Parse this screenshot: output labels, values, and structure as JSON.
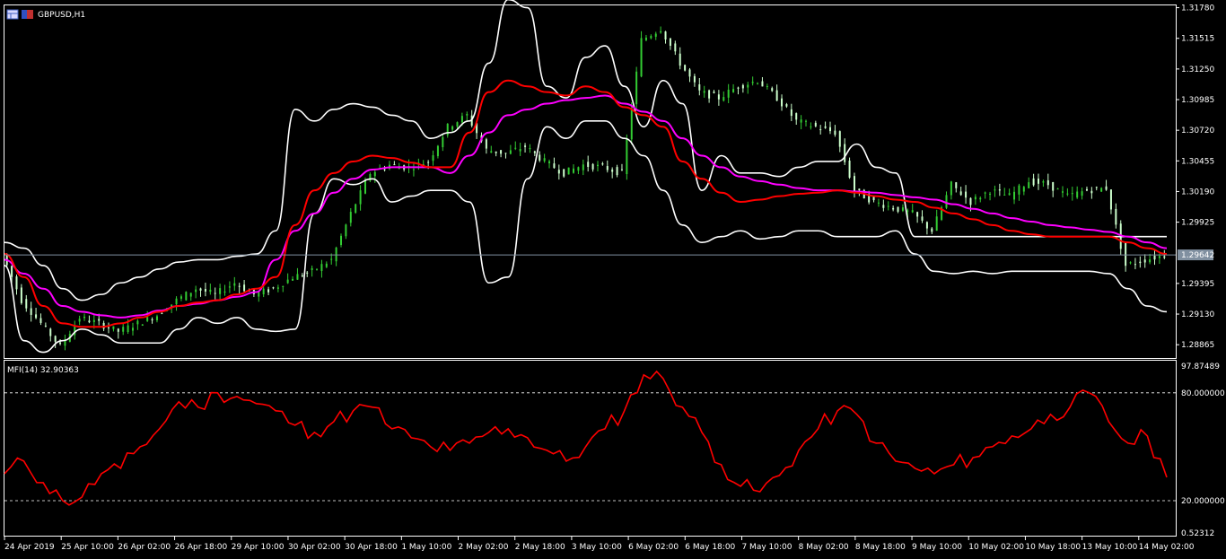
{
  "window": {
    "symbol_label": "GBPUSD,H1",
    "indicator_label": "MFI(14) 32.90363",
    "current_price_label": "1.29642"
  },
  "colors": {
    "background": "#000000",
    "frame": "#ffffff",
    "bull_candle": "#33cc33",
    "bear_candle": "#ccffcc",
    "bands": "#ffffff",
    "ma_fast": "#ff0000",
    "ma_slow": "#ff00ff",
    "mfi": "#ff0000",
    "price_line": "#8090a0",
    "price_label_bg": "#8090a0"
  },
  "chart_data": [
    {
      "type": "line",
      "title": "GBPUSD,H1",
      "price_axis_ticks": [
        "1.31780",
        "1.31515",
        "1.31250",
        "1.30985",
        "1.30720",
        "1.30455",
        "1.30190",
        "1.29925",
        "1.29642",
        "1.29395",
        "1.29130",
        "1.28865"
      ],
      "time_axis_labels": [
        "24 Apr 2019",
        "25 Apr 10:00",
        "26 Apr 02:00",
        "26 Apr 18:00",
        "29 Apr 10:00",
        "30 Apr 02:00",
        "30 Apr 18:00",
        "1 May 10:00",
        "2 May 02:00",
        "2 May 18:00",
        "3 May 10:00",
        "6 May 02:00",
        "6 May 18:00",
        "7 May 10:00",
        "8 May 02:00",
        "8 May 18:00",
        "9 May 10:00",
        "10 May 02:00",
        "10 May 18:00",
        "13 May 10:00",
        "14 May 02:00"
      ],
      "ylim": [
        1.2875,
        1.318
      ],
      "current_price": 1.29642,
      "x": [
        0,
        5,
        10,
        15,
        20,
        25,
        30,
        35,
        40,
        45,
        50,
        55,
        60,
        65,
        70,
        75,
        80,
        85,
        90,
        95,
        100,
        105,
        110,
        115,
        120,
        125,
        130,
        135,
        140,
        145,
        150,
        155,
        160,
        165,
        170,
        175,
        180,
        185,
        190,
        195,
        200,
        205,
        210,
        215,
        220,
        225,
        230,
        235,
        240,
        245,
        250,
        255,
        260,
        265,
        270,
        275,
        280,
        285,
        290,
        295,
        300
      ],
      "series": [
        {
          "name": "Close",
          "values": [
            1.2965,
            1.2925,
            1.2905,
            1.2885,
            1.291,
            1.2905,
            1.2898,
            1.2905,
            1.2912,
            1.2925,
            1.2935,
            1.293,
            1.294,
            1.293,
            1.2935,
            1.2945,
            1.295,
            1.296,
            1.3,
            1.3035,
            1.3042,
            1.304,
            1.3045,
            1.3075,
            1.3085,
            1.3055,
            1.3052,
            1.3058,
            1.3045,
            1.3035,
            1.3042,
            1.304,
            1.3035,
            1.315,
            1.316,
            1.313,
            1.3105,
            1.31,
            1.311,
            1.3115,
            1.31,
            1.308,
            1.3075,
            1.307,
            1.302,
            1.301,
            1.3005,
            1.3,
            1.2985,
            1.3025,
            1.301,
            1.302,
            1.3015,
            1.3028,
            1.3025,
            1.3015,
            1.302,
            1.3022,
            1.2955,
            1.296,
            1.2964
          ]
        },
        {
          "name": "Upper band",
          "values": [
            1.2975,
            1.297,
            1.2955,
            1.2935,
            1.2925,
            1.293,
            1.294,
            1.2945,
            1.2952,
            1.2958,
            1.296,
            1.296,
            1.2963,
            1.2965,
            1.2985,
            1.309,
            1.308,
            1.309,
            1.3095,
            1.3092,
            1.3085,
            1.308,
            1.3065,
            1.307,
            1.308,
            1.313,
            1.3185,
            1.3178,
            1.311,
            1.31,
            1.3135,
            1.3145,
            1.311,
            1.3075,
            1.3115,
            1.3095,
            1.302,
            1.305,
            1.3035,
            1.3035,
            1.3032,
            1.304,
            1.3045,
            1.3045,
            1.306,
            1.304,
            1.3035,
            1.298,
            1.298,
            1.298,
            1.298,
            1.298,
            1.298,
            1.298,
            1.298,
            1.298,
            1.298,
            1.298,
            1.298,
            1.298,
            1.298
          ]
        },
        {
          "name": "Lower band",
          "values": [
            1.2955,
            1.289,
            1.288,
            1.289,
            1.29,
            1.2895,
            1.2888,
            1.2888,
            1.2888,
            1.29,
            1.291,
            1.2905,
            1.291,
            1.29,
            1.2898,
            1.29,
            1.3,
            1.303,
            1.3025,
            1.303,
            1.301,
            1.3015,
            1.302,
            1.302,
            1.301,
            1.294,
            1.2945,
            1.303,
            1.3075,
            1.3065,
            1.308,
            1.308,
            1.3065,
            1.305,
            1.302,
            1.299,
            1.2975,
            1.298,
            1.2985,
            1.2978,
            1.298,
            1.2985,
            1.2985,
            1.298,
            1.298,
            1.298,
            1.2985,
            1.2965,
            1.295,
            1.2948,
            1.295,
            1.2948,
            1.295,
            1.295,
            1.295,
            1.295,
            1.295,
            1.2948,
            1.2935,
            1.292,
            1.2915
          ]
        },
        {
          "name": "Fast MA",
          "values": [
            1.2965,
            1.2945,
            1.292,
            1.2905,
            1.2902,
            1.2902,
            1.2905,
            1.291,
            1.2915,
            1.292,
            1.2923,
            1.2925,
            1.293,
            1.2935,
            1.2945,
            1.299,
            1.302,
            1.3035,
            1.3045,
            1.305,
            1.3048,
            1.3044,
            1.304,
            1.304,
            1.307,
            1.3105,
            1.3115,
            1.311,
            1.3105,
            1.3102,
            1.311,
            1.3105,
            1.3092,
            1.3085,
            1.3075,
            1.3045,
            1.303,
            1.3018,
            1.301,
            1.3012,
            1.3015,
            1.3017,
            1.3018,
            1.302,
            1.3018,
            1.3015,
            1.3012,
            1.301,
            1.3005,
            1.3,
            1.2995,
            1.299,
            1.2985,
            1.2982,
            1.298,
            1.298,
            1.298,
            1.298,
            1.2975,
            1.297,
            1.2965
          ]
        },
        {
          "name": "Slow MA",
          "values": [
            1.296,
            1.2948,
            1.2935,
            1.292,
            1.2915,
            1.2912,
            1.291,
            1.2912,
            1.2916,
            1.292,
            1.2922,
            1.2925,
            1.2928,
            1.2932,
            1.296,
            1.2985,
            1.3,
            1.3018,
            1.303,
            1.3038,
            1.304,
            1.304,
            1.304,
            1.3035,
            1.305,
            1.307,
            1.3085,
            1.309,
            1.3095,
            1.3098,
            1.31,
            1.3102,
            1.3095,
            1.3088,
            1.308,
            1.3065,
            1.305,
            1.304,
            1.3032,
            1.3028,
            1.3025,
            1.3022,
            1.302,
            1.302,
            1.3019,
            1.3018,
            1.3016,
            1.3014,
            1.3012,
            1.3008,
            1.3004,
            1.3,
            1.2996,
            1.2993,
            1.299,
            1.2988,
            1.2986,
            1.2984,
            1.298,
            1.2975,
            1.297
          ]
        }
      ]
    },
    {
      "type": "line",
      "title": "MFI(14) 32.90363",
      "y_axis_ticks": [
        "97.87489",
        "80.000000",
        "20.000000",
        "0.52312"
      ],
      "levels": [
        80,
        20
      ],
      "ylim": [
        0.52312,
        97.87489
      ],
      "x": [
        0,
        5,
        10,
        15,
        20,
        25,
        30,
        35,
        40,
        45,
        50,
        55,
        60,
        65,
        70,
        75,
        80,
        85,
        90,
        95,
        100,
        105,
        110,
        115,
        120,
        125,
        130,
        135,
        140,
        145,
        150,
        155,
        160,
        165,
        170,
        175,
        180,
        185,
        190,
        195,
        200,
        205,
        210,
        215,
        220,
        225,
        230,
        235,
        240,
        245,
        250,
        255,
        260,
        265,
        270,
        275,
        280,
        285,
        290,
        295,
        300
      ],
      "series": [
        {
          "name": "MFI(14)",
          "values": [
            35,
            42,
            30,
            20,
            22,
            35,
            38,
            50,
            60,
            75,
            72,
            80,
            78,
            74,
            70,
            62,
            58,
            64,
            70,
            72,
            60,
            55,
            50,
            48,
            52,
            58,
            60,
            55,
            48,
            42,
            50,
            60,
            70,
            90,
            88,
            72,
            58,
            40,
            28,
            25,
            34,
            48,
            60,
            70,
            68,
            52,
            42,
            38,
            35,
            40,
            44,
            50,
            56,
            60,
            68,
            72,
            80,
            64,
            52,
            56,
            33
          ]
        }
      ]
    }
  ]
}
